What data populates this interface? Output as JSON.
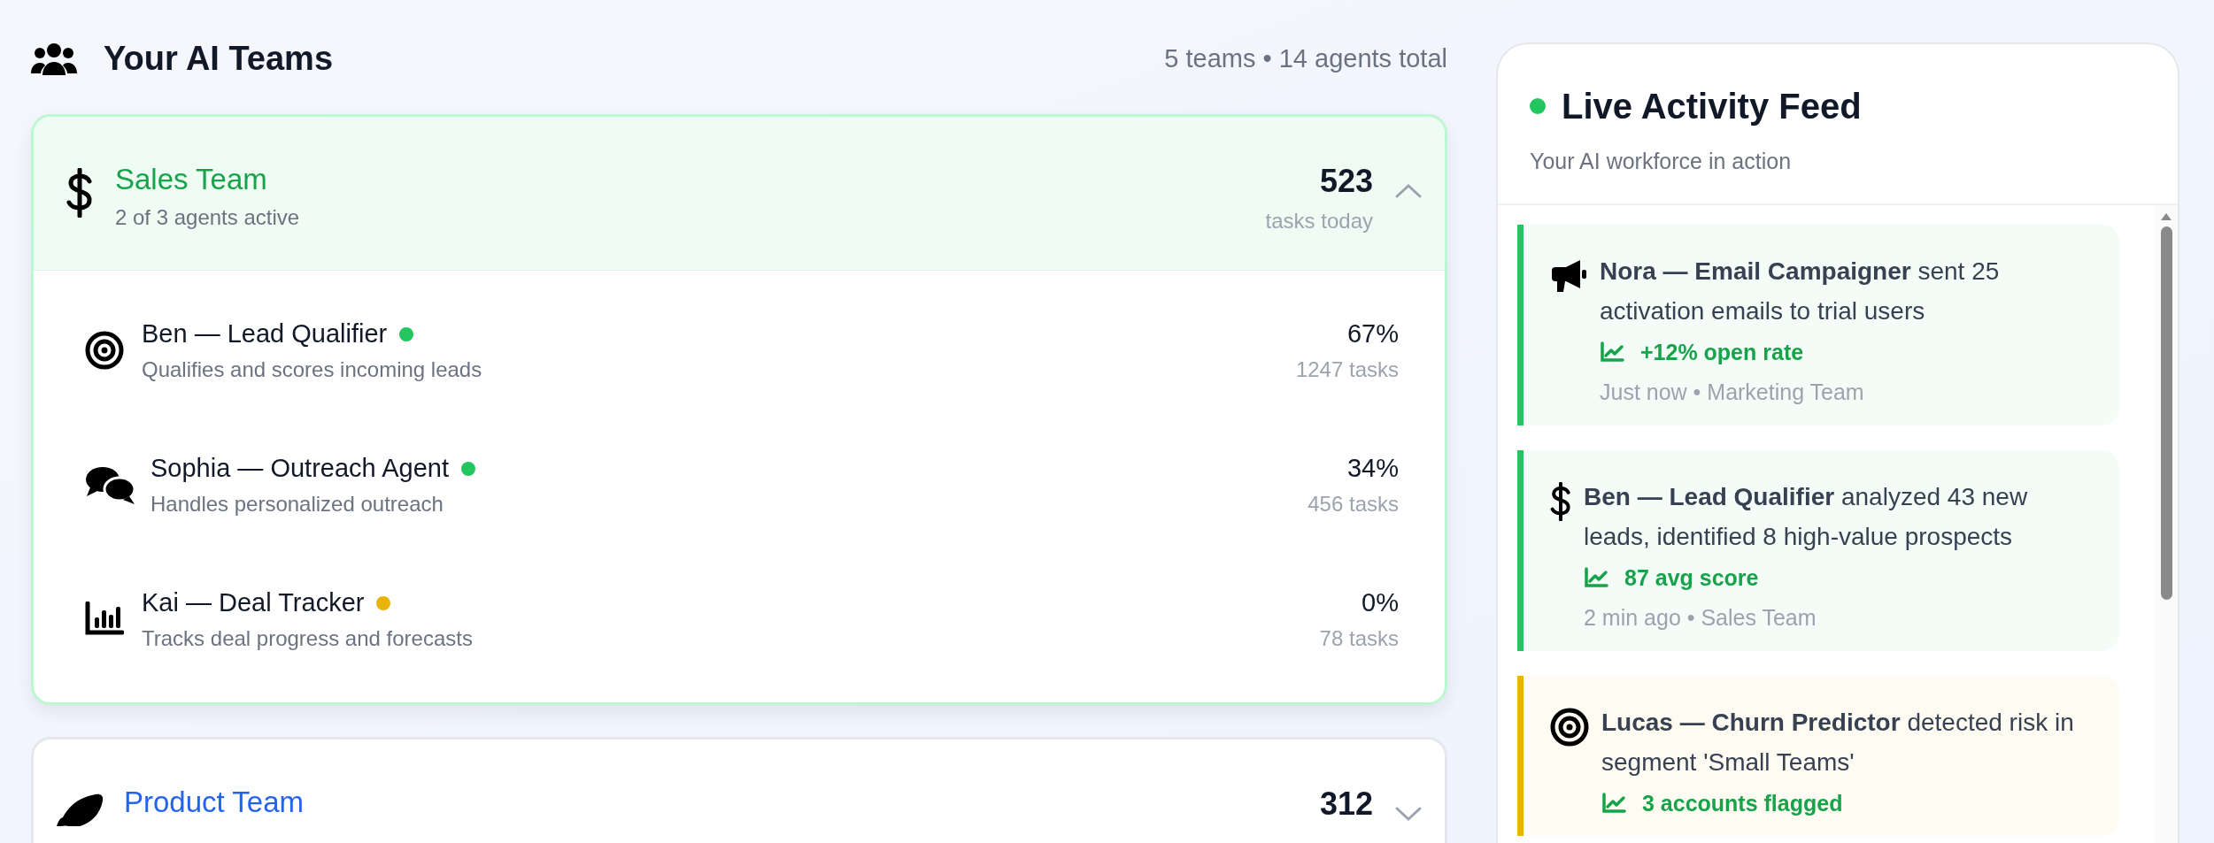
{
  "teams_header": {
    "title": "Your AI Teams",
    "summary": "5 teams • 14 agents total"
  },
  "teams": [
    {
      "name": "Sales Team",
      "color": "#16a34a",
      "subtitle": "2 of 3 agents active",
      "tasks": "523",
      "tasks_label": "tasks today",
      "expanded": true,
      "agents": [
        {
          "name": "Ben — Lead Qualifier",
          "color": "#22c55e",
          "description": "Qualifies and scores incoming leads",
          "share": "67%",
          "tasks": "1247 tasks"
        },
        {
          "name": "Sophia — Outreach Agent",
          "color": "#22c55e",
          "description": "Handles personalized outreach",
          "share": "34%",
          "tasks": "456 tasks"
        },
        {
          "name": "Kai — Deal Tracker",
          "color": "#eab308",
          "description": "Tracks deal progress and forecasts",
          "share": "0%",
          "tasks": "78 tasks"
        }
      ]
    },
    {
      "name": "Product Team",
      "color": "#2563eb",
      "tasks": "312",
      "expanded": false
    }
  ],
  "feed": {
    "title": "Live Activity Feed",
    "subtitle": "Your AI workforce in action",
    "items": [
      {
        "color": "#22c55e",
        "text": "**Nora — Email Campaigner** sent 25 activation emails to trial users",
        "metric": "+12% open rate",
        "meta": "Just now • Marketing Team"
      },
      {
        "color": "#22c55e",
        "text": "**Ben — Lead Qualifier** analyzed 43 new leads, identified 8 high-value prospects",
        "metric": "87 avg score",
        "meta": "2 min ago • Sales Team"
      },
      {
        "color": "#eab308",
        "text": "**Lucas — Churn Predictor** detected risk in segment 'Small Teams'",
        "metric": "3 accounts flagged"
      }
    ]
  }
}
